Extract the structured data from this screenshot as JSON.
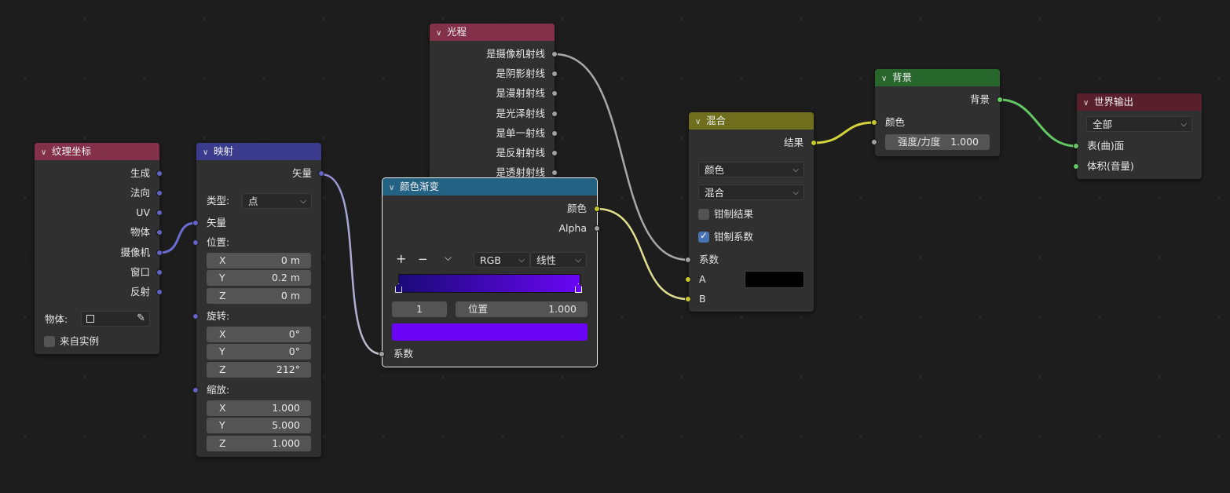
{
  "nodes": {
    "texcoord": {
      "title": "纹理坐标",
      "outputs": [
        "生成",
        "法向",
        "UV",
        "物体",
        "摄像机",
        "窗口",
        "反射"
      ],
      "object_label": "物体:",
      "from_instancer_label": "来自实例",
      "from_instancer_checked": false
    },
    "mapping": {
      "title": "映射",
      "output": "矢量",
      "type_label": "类型:",
      "type_value": "点",
      "input_vector": "矢量",
      "location_label": "位置:",
      "location": [
        {
          "axis": "X",
          "value": "0 m"
        },
        {
          "axis": "Y",
          "value": "0.2 m"
        },
        {
          "axis": "Z",
          "value": "0 m"
        }
      ],
      "rotation_label": "旋转:",
      "rotation": [
        {
          "axis": "X",
          "value": "0°"
        },
        {
          "axis": "Y",
          "value": "0°"
        },
        {
          "axis": "Z",
          "value": "212°"
        }
      ],
      "scale_label": "缩放:",
      "scale": [
        {
          "axis": "X",
          "value": "1.000"
        },
        {
          "axis": "Y",
          "value": "5.000"
        },
        {
          "axis": "Z",
          "value": "1.000"
        }
      ]
    },
    "lightpath": {
      "title": "光程",
      "outputs": [
        "是摄像机射线",
        "是阴影射线",
        "是漫射射线",
        "是光泽射线",
        "是单一射线",
        "是反射射线",
        "是透射射线"
      ]
    },
    "colorramp": {
      "title": "颜色渐变",
      "out_color": "颜色",
      "out_alpha": "Alpha",
      "add_btn": "+",
      "remove_btn": "−",
      "menu_btn": "⌵",
      "color_mode": "RGB",
      "interpolation": "线性",
      "stop_index": "1",
      "pos_label": "位置",
      "pos_value": "1.000",
      "ramp_start_color": "#1a0a78",
      "ramp_end_color": "#6a06f5",
      "stop_color": "#6a06f5",
      "input_fac": "系数"
    },
    "mix": {
      "title": "混合",
      "output": "结果",
      "data_type": "颜色",
      "blend_mode": "混合",
      "clamp_result_label": "钳制结果",
      "clamp_result_checked": false,
      "clamp_factor_label": "钳制系数",
      "clamp_factor_checked": true,
      "in_fac": "系数",
      "in_a": "A",
      "in_b": "B",
      "a_color": "#000000"
    },
    "background": {
      "title": "背景",
      "output": "背景",
      "in_color": "颜色",
      "strength_label": "强度/力度",
      "strength_value": "1.000"
    },
    "worldout": {
      "title": "世界输出",
      "target": "全部",
      "in_surface": "表(曲)面",
      "in_volume": "体积(音量)"
    }
  },
  "colors": {
    "header_input": "#83314a",
    "header_vector": "#3b3b8e",
    "header_converter": "#246283",
    "header_color": "#6e6e1d",
    "header_shader": "#28672c",
    "header_output": "#5a1f2d",
    "socket_vector": "#6363c7",
    "socket_float": "#a1a1a1",
    "socket_color": "#c7c729",
    "socket_shader": "#63c763"
  }
}
